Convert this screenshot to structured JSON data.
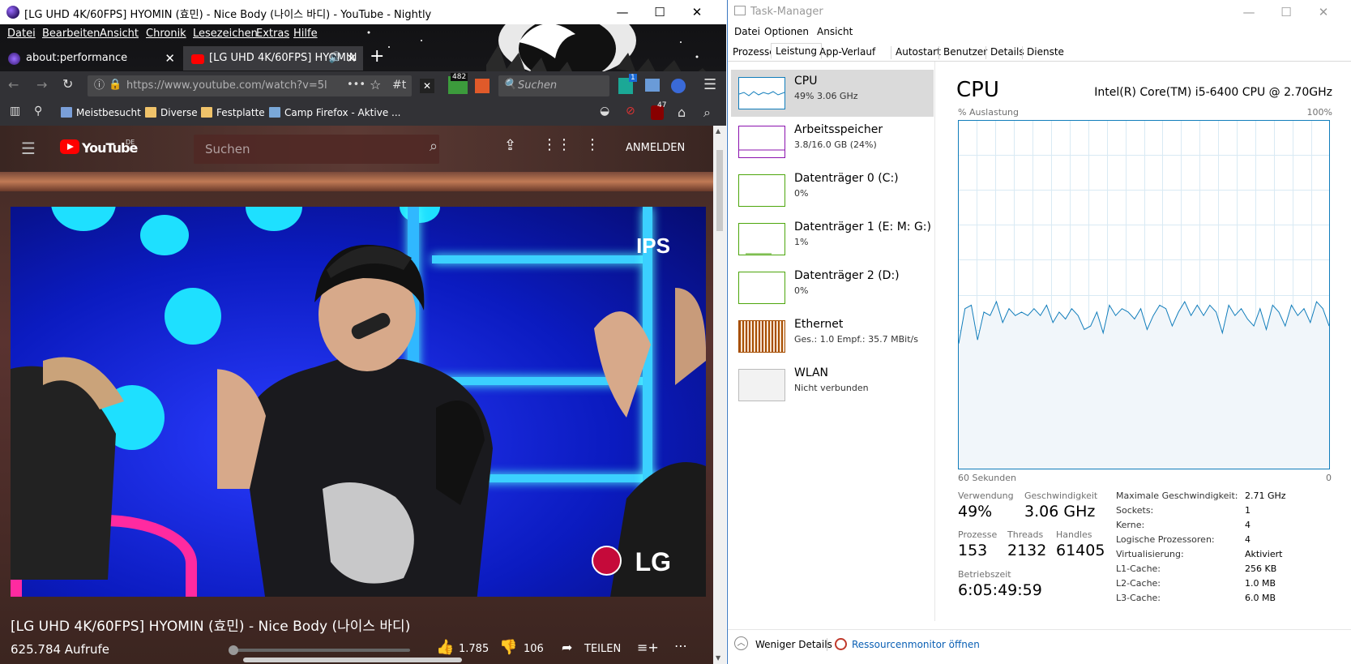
{
  "firefox": {
    "window_title": "[LG UHD 4K/60FPS] HYOMIN (효민) - Nice Body (나이스 바디) - YouTube - Nightly",
    "menu": [
      "Datei",
      "Bearbeiten",
      "Ansicht",
      "Chronik",
      "Lesezeichen",
      "Extras",
      "Hilfe"
    ],
    "tabs": [
      {
        "label": "about:performance",
        "active": false
      },
      {
        "label": "[LG UHD 4K/60FPS] HYOMIN",
        "active": true
      }
    ],
    "url": "https://www.youtube.com/watch?v=5l",
    "url_extras": [
      "•••",
      "#t"
    ],
    "search_placeholder": "Suchen",
    "badges": {
      "ext1": "482",
      "ext2": "1",
      "ublock": "47"
    },
    "bookmarks": [
      "Meistbesucht",
      "Diverse",
      "Festplatte",
      "Camp Firefox - Aktive ..."
    ]
  },
  "youtube": {
    "logo": "YouTube",
    "region": "DE",
    "search_placeholder": "Suchen",
    "signin": "ANMELDEN",
    "overlay_ips": "IPS",
    "overlay_lg": "LG",
    "video_title": "[LG UHD 4K/60FPS] HYOMIN (효민) - Nice Body (나이스 바디)",
    "views": "625.784 Aufrufe",
    "likes": "1.785",
    "dislikes": "106",
    "share": "TEILEN"
  },
  "taskmanager": {
    "title": "Task-Manager",
    "menu": [
      "Datei",
      "Optionen",
      "Ansicht"
    ],
    "tabs": [
      "Prozesse",
      "Leistung",
      "App-Verlauf",
      "Autostart",
      "Benutzer",
      "Details",
      "Dienste"
    ],
    "active_tab": "Leistung",
    "resources": [
      {
        "name": "CPU",
        "sub": "49% 3.06 GHz",
        "selected": true
      },
      {
        "name": "Arbeitsspeicher",
        "sub": "3.8/16.0 GB (24%)"
      },
      {
        "name": "Datenträger 0 (C:)",
        "sub": "0%"
      },
      {
        "name": "Datenträger 1 (E: M: G:)",
        "sub": "1%"
      },
      {
        "name": "Datenträger 2 (D:)",
        "sub": "0%"
      },
      {
        "name": "Ethernet",
        "sub": "Ges.: 1.0 Empf.: 35.7 MBit/s"
      },
      {
        "name": "WLAN",
        "sub": "Nicht verbunden"
      }
    ],
    "cpu": {
      "heading": "CPU",
      "model": "Intel(R) Core(TM) i5-6400 CPU @ 2.70GHz",
      "y_label": "% Auslastung",
      "y_max": "100%",
      "x_left": "60 Sekunden",
      "x_right": "0",
      "usage_label": "Verwendung",
      "usage": "49%",
      "speed_label": "Geschwindigkeit",
      "speed": "3.06 GHz",
      "proc_label": "Prozesse",
      "proc": "153",
      "threads_label": "Threads",
      "threads": "2132",
      "handles_label": "Handles",
      "handles": "61405",
      "uptime_label": "Betriebszeit",
      "uptime": "6:05:49:59",
      "specs": [
        {
          "k": "Maximale Geschwindigkeit:",
          "v": "2.71 GHz"
        },
        {
          "k": "Sockets:",
          "v": "1"
        },
        {
          "k": "Kerne:",
          "v": "4"
        },
        {
          "k": "Logische Prozessoren:",
          "v": "4"
        },
        {
          "k": "Virtualisierung:",
          "v": "Aktiviert"
        },
        {
          "k": "L1-Cache:",
          "v": "256 KB"
        },
        {
          "k": "L2-Cache:",
          "v": "1.0 MB"
        },
        {
          "k": "L3-Cache:",
          "v": "6.0 MB"
        }
      ]
    },
    "fewer_details": "Weniger Details",
    "resmon": "Ressourcenmonitor öffnen",
    "colors": {
      "cpu_line": "#117dbb",
      "cpu_fill": "#f1f6fa",
      "memory": "#8b12ae",
      "disk": "#4da60c",
      "net": "#a74f01"
    },
    "cpu_history": [
      36,
      46,
      47,
      37,
      45,
      44,
      48,
      42,
      46,
      44,
      45,
      44,
      46,
      44,
      47,
      42,
      45,
      43,
      46,
      44,
      40,
      41,
      45,
      39,
      47,
      44,
      46,
      45,
      43,
      46,
      40,
      44,
      47,
      46,
      41,
      45,
      48,
      44,
      47,
      44,
      47,
      45,
      39,
      47,
      44,
      46,
      43,
      41,
      46,
      40,
      47,
      45,
      41,
      47,
      44,
      46,
      42,
      48,
      46,
      41
    ]
  }
}
